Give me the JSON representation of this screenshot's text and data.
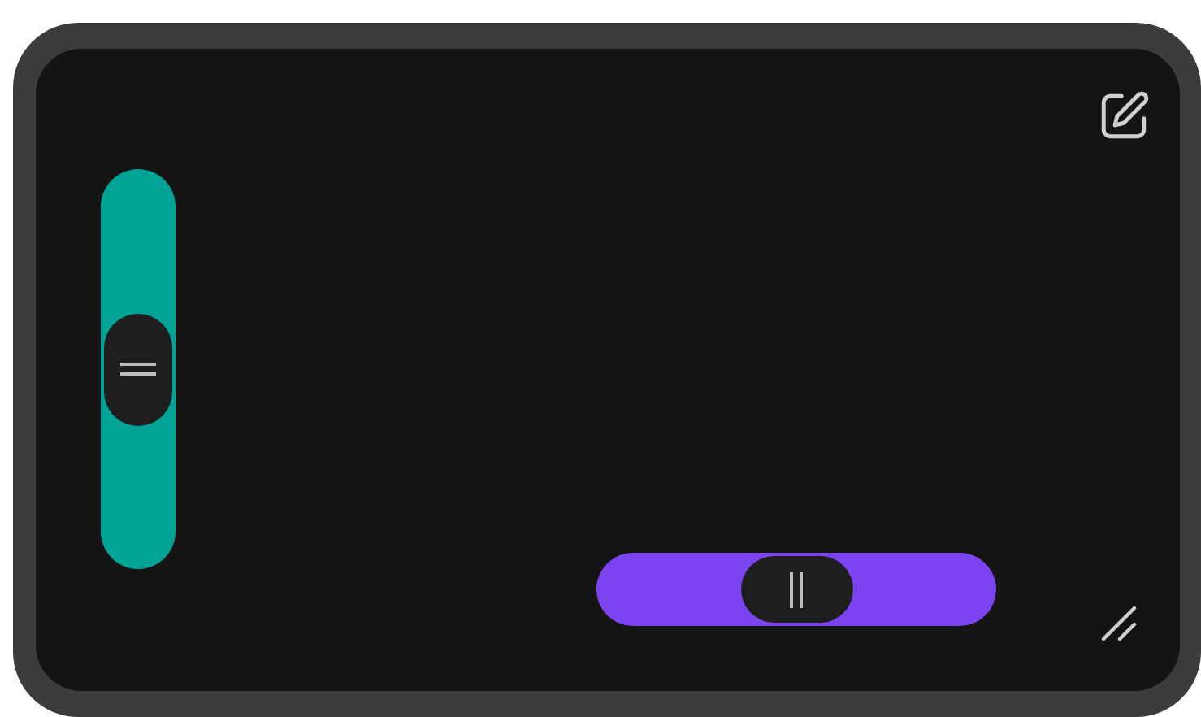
{
  "sliders": [
    {
      "kind": "vertical",
      "level": 0.5,
      "color": "#00a396"
    },
    {
      "kind": "horizontal",
      "level": 0.5,
      "color": "#7b44f0"
    }
  ]
}
